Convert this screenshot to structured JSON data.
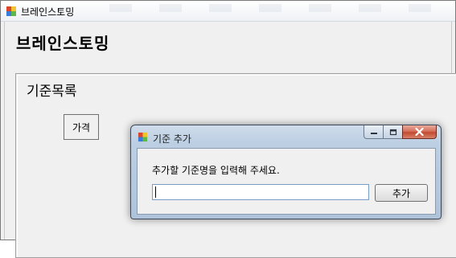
{
  "main_window": {
    "title": "브레인스토밍",
    "heading": "브레인스토밍",
    "group_title": "기준목록",
    "price_button_label": "가격"
  },
  "dialog": {
    "title": "기준 추가",
    "prompt": "추가할 기준명을 입력해 주세요.",
    "input_value": "",
    "add_button_label": "추가"
  },
  "icons": {
    "app_icon": "app-icon",
    "minimize": "minimize-icon",
    "maximize": "maximize-icon",
    "close": "close-icon"
  },
  "colors": {
    "dialog_frame": "#bccfe3",
    "close_button": "#c24a30",
    "window_bg": "#f0f0f0"
  }
}
